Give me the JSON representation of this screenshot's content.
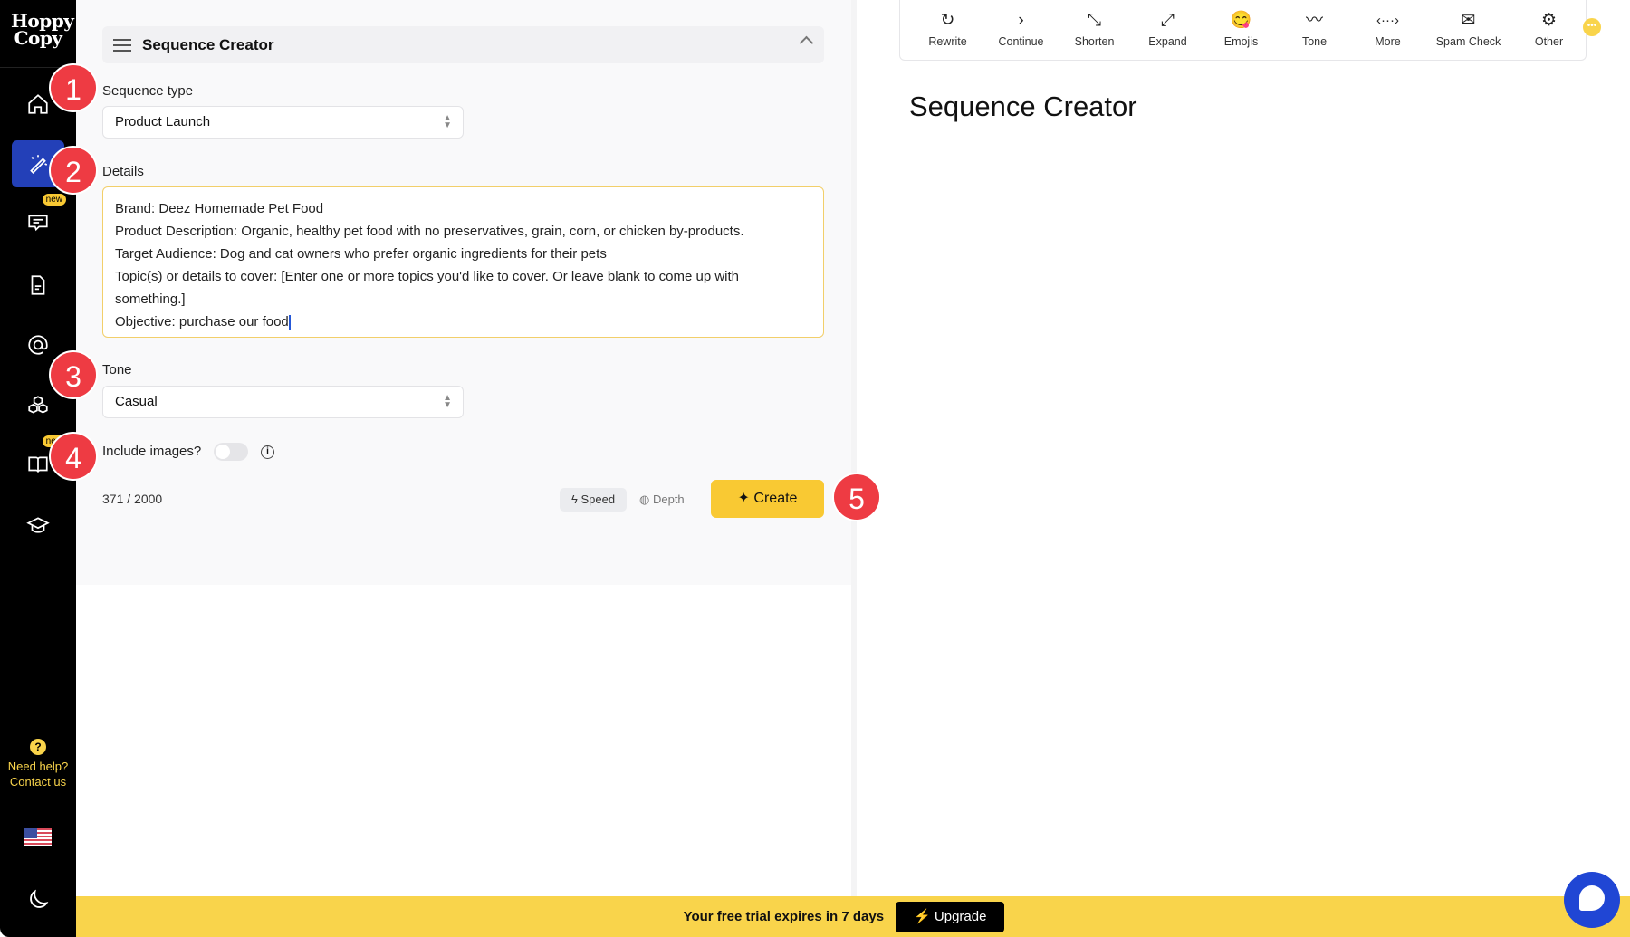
{
  "app": {
    "logo": "Hoppy Copy"
  },
  "sidebar": {
    "items": [
      {
        "name": "home",
        "icon": "home-icon"
      },
      {
        "name": "magic",
        "icon": "magic-wand-icon",
        "active": true
      },
      {
        "name": "chat",
        "icon": "chat-icon",
        "badge": "new"
      },
      {
        "name": "document",
        "icon": "document-icon"
      },
      {
        "name": "email",
        "icon": "at-icon"
      },
      {
        "name": "cubes",
        "icon": "cubes-icon"
      },
      {
        "name": "book",
        "icon": "book-icon",
        "badge": "new"
      },
      {
        "name": "learn",
        "icon": "graduation-cap-icon"
      }
    ],
    "help_line1": "Need help?",
    "help_line2": "Contact us",
    "help_icon": "?"
  },
  "panel": {
    "title": "Sequence Creator",
    "sequence_type_label": "Sequence type",
    "sequence_type_value": "Product Launch",
    "details_label": "Details",
    "details_lines": [
      "Brand: Deez Homemade Pet Food",
      "Product Description: Organic, healthy pet food with no preservatives, grain, corn, or chicken by-products.",
      "Target Audience: Dog and cat owners who prefer organic ingredients for their pets",
      "Topic(s) or details to cover: [Enter one or more topics you'd like to cover. Or leave blank to come up with",
      "something.]",
      "Objective: purchase our food"
    ],
    "tone_label": "Tone",
    "tone_value": "Casual",
    "include_images_label": "Include images?",
    "include_images": false,
    "char_count": "371 / 2000",
    "speed": "Speed",
    "depth": "Depth",
    "create": "Create"
  },
  "annotations": [
    "1",
    "2",
    "3",
    "4",
    "5"
  ],
  "toolbar": [
    {
      "label": "Rewrite",
      "icon": "↻"
    },
    {
      "label": "Continue",
      "icon": "›"
    },
    {
      "label": "Shorten",
      "icon": "⤡"
    },
    {
      "label": "Expand",
      "icon": "⤢"
    },
    {
      "label": "Emojis",
      "icon": "😋"
    },
    {
      "label": "Tone",
      "icon": "〰"
    },
    {
      "label": "More",
      "icon": "‹···›"
    },
    {
      "label": "Spam Check",
      "icon": "✉"
    },
    {
      "label": "Other",
      "icon": "⚙"
    }
  ],
  "editor": {
    "title": "Sequence Creator"
  },
  "banner": {
    "message": "Your free trial expires in 7 days",
    "upgrade": "⚡ Upgrade"
  },
  "colors": {
    "accent": "#f9c933",
    "banner": "#f9d44b",
    "active_nav": "#2340b8",
    "annotation": "#ee3b43"
  }
}
